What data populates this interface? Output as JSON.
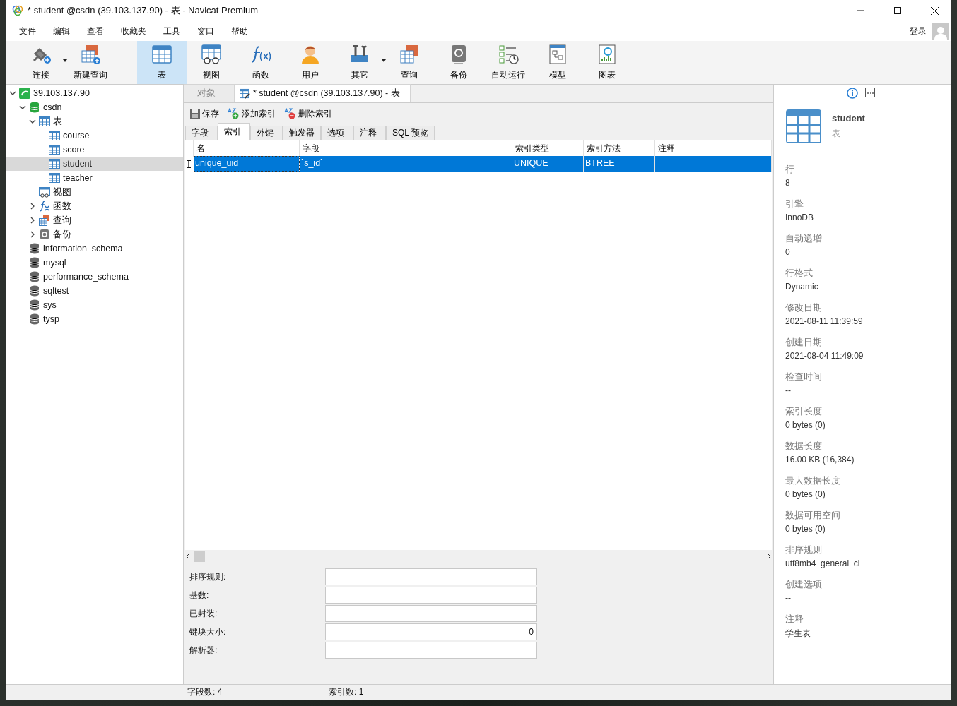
{
  "window": {
    "title": "* student @csdn (39.103.137.90) - 表 - Navicat Premium"
  },
  "menu": [
    "文件",
    "编辑",
    "查看",
    "收藏夹",
    "工具",
    "窗口",
    "帮助"
  ],
  "login": "登录",
  "toolbar": [
    {
      "kind": "connect",
      "label": "连接",
      "dropdown": true,
      "selected": false
    },
    {
      "kind": "new-query",
      "label": "新建查询",
      "dropdown": false,
      "selected": false
    },
    {
      "kind": "table",
      "label": "表",
      "dropdown": false,
      "selected": true
    },
    {
      "kind": "view",
      "label": "视图",
      "dropdown": false,
      "selected": false
    },
    {
      "kind": "function",
      "label": "函数",
      "dropdown": false,
      "selected": false
    },
    {
      "kind": "user",
      "label": "用户",
      "dropdown": false,
      "selected": false
    },
    {
      "kind": "other",
      "label": "其它",
      "dropdown": true,
      "selected": false
    },
    {
      "kind": "query",
      "label": "查询",
      "dropdown": false,
      "selected": false
    },
    {
      "kind": "backup",
      "label": "备份",
      "dropdown": false,
      "selected": false
    },
    {
      "kind": "auto",
      "label": "自动运行",
      "dropdown": false,
      "selected": false
    },
    {
      "kind": "model",
      "label": "模型",
      "dropdown": false,
      "selected": false
    },
    {
      "kind": "chart",
      "label": "图表",
      "dropdown": false,
      "selected": false
    }
  ],
  "tree": [
    {
      "kind": "server",
      "label": "39.103.137.90",
      "expanded": true,
      "selected": false,
      "children": [
        {
          "kind": "database",
          "label": "csdn",
          "expanded": true,
          "selected": false,
          "children": [
            {
              "kind": "tables",
              "label": "表",
              "expanded": true,
              "selected": false,
              "children": [
                {
                  "kind": "table",
                  "label": "course",
                  "selected": false
                },
                {
                  "kind": "table",
                  "label": "score",
                  "selected": false
                },
                {
                  "kind": "table",
                  "label": "student",
                  "selected": true
                },
                {
                  "kind": "table",
                  "label": "teacher",
                  "selected": false
                }
              ]
            },
            {
              "kind": "view",
              "label": "视图",
              "selected": false
            },
            {
              "kind": "function",
              "label": "函数",
              "expanded": false,
              "selected": false
            },
            {
              "kind": "query",
              "label": "查询",
              "expanded": false,
              "selected": false
            },
            {
              "kind": "backup",
              "label": "备份",
              "expanded": false,
              "selected": false
            }
          ]
        },
        {
          "kind": "db-gray",
          "label": "information_schema",
          "selected": false
        },
        {
          "kind": "db-gray",
          "label": "mysql",
          "selected": false
        },
        {
          "kind": "db-gray",
          "label": "performance_schema",
          "selected": false
        },
        {
          "kind": "db-gray",
          "label": "sqltest",
          "selected": false
        },
        {
          "kind": "db-gray",
          "label": "sys",
          "selected": false
        },
        {
          "kind": "db-gray",
          "label": "tysp",
          "selected": false
        }
      ]
    }
  ],
  "doc_tabs": [
    {
      "label": "对象",
      "selected": false,
      "icon": false
    },
    {
      "label": "* student @csdn (39.103.137.90) - 表",
      "selected": true,
      "icon": true
    }
  ],
  "actions": [
    {
      "kind": "save",
      "label": "保存"
    },
    {
      "kind": "add",
      "label": "添加索引"
    },
    {
      "kind": "delete",
      "label": "删除索引"
    }
  ],
  "sub_tabs": [
    {
      "label": "字段",
      "selected": false
    },
    {
      "label": "索引",
      "selected": true
    },
    {
      "label": "外键",
      "selected": false
    },
    {
      "label": "触发器",
      "selected": false
    },
    {
      "label": "选项",
      "selected": false
    },
    {
      "label": "注释",
      "selected": false
    },
    {
      "label": "SQL 预览",
      "selected": false
    }
  ],
  "table": {
    "columns": [
      "名",
      "字段",
      "索引类型",
      "索引方法",
      "注释"
    ],
    "rows": [
      {
        "cells": [
          "unique_uid",
          "`s_id`",
          "UNIQUE",
          "BTREE"
        ],
        "selected": true
      }
    ]
  },
  "form": [
    {
      "label": "排序规则:"
    },
    {
      "label": "基数:"
    },
    {
      "label": "已封装:"
    },
    {
      "label": "键块大小:",
      "value": "0"
    },
    {
      "label": "解析器:"
    }
  ],
  "info": {
    "name": "student",
    "type": "表",
    "properties": [
      {
        "label": "行",
        "value": "8"
      },
      {
        "label": "引擎",
        "value": "InnoDB"
      },
      {
        "label": "自动递增",
        "value": "0"
      },
      {
        "label": "行格式",
        "value": "Dynamic"
      },
      {
        "label": "修改日期",
        "value": "2021-08-11 11:39:59"
      },
      {
        "label": "创建日期",
        "value": "2021-08-04 11:49:09"
      },
      {
        "label": "检查时间",
        "value": "--"
      },
      {
        "label": "索引长度",
        "value": "0 bytes (0)"
      },
      {
        "label": "数据长度",
        "value": "16.00 KB (16,384)"
      },
      {
        "label": "最大数据长度",
        "value": "0 bytes (0)"
      },
      {
        "label": "数据可用空间",
        "value": "0 bytes (0)"
      },
      {
        "label": "排序规则",
        "value": "utf8mb4_general_ci"
      },
      {
        "label": "创建选项",
        "value": "--"
      },
      {
        "label": "注释",
        "value": "学生表"
      }
    ]
  },
  "status_bar": [
    "字段数: 4",
    "索引数: 1"
  ]
}
